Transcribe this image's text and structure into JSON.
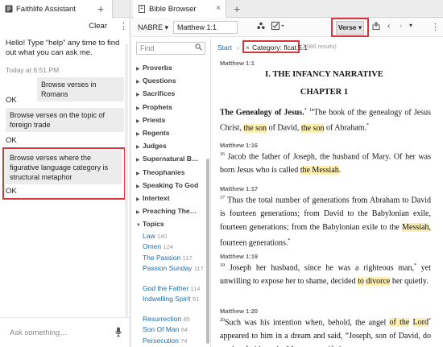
{
  "assistant": {
    "tab_title": "Faithlife Assistant",
    "tab_add": "+",
    "clear_label": "Clear",
    "kebab": "⋮",
    "greeting": "Hello! Type “help” any time to find out what you can ask me.",
    "timestamp": "Today at 6:51 PM",
    "messages": [
      {
        "user": "Browse verses in Romans",
        "reply": "OK"
      },
      {
        "user": "Browse verses on the topic of foreign trade",
        "reply": "OK"
      },
      {
        "user": "Browse verses where the figurative language category is structural metaphor",
        "reply": "OK"
      }
    ],
    "ask_placeholder": "Ask something…",
    "mic_icon": "microphone-icon"
  },
  "browser": {
    "tab_title": "Bible Browser",
    "tab_add": "+",
    "version": "NABRE",
    "reference": "Matthew 1:1",
    "verse_button": "Verse",
    "filter_placeholder": "Find",
    "filters": [
      "Proverbs",
      "Questions",
      "Sacrifices",
      "Prophets",
      "Priests",
      "Regents",
      "Judges",
      "Supernatural B…",
      "Theophanies",
      "Speaking To God",
      "Intertext",
      "Preaching The…",
      "Topics"
    ],
    "topics": [
      {
        "name": "Law",
        "count": "140"
      },
      {
        "name": "Omen",
        "count": "124"
      },
      {
        "name": "The Passion",
        "count": "117"
      },
      {
        "name": "Passion Sunday",
        "count": "117"
      },
      {
        "name": "God the Father",
        "count": "114"
      },
      {
        "name": "Indwelling Spirit",
        "count": "91"
      },
      {
        "name": "Resurrection",
        "count": "85"
      },
      {
        "name": "Son Of Man",
        "count": "84"
      },
      {
        "name": "Persecution",
        "count": "74"
      }
    ],
    "crumbs": {
      "start": "Start",
      "sep": "›",
      "category": "Category: flcat.5.1",
      "close": "×",
      "results": "(3,986 results)"
    },
    "passage": {
      "ref1": "Matthew 1:1",
      "heading1": "I. THE INFANCY NARRATIVE",
      "heading2": "CHAPTER 1",
      "subheading": "The Genealogy of Jesus.",
      "v1_num": "1",
      "v1_a": "The book of the genealogy of Jesus Christ, ",
      "v1_hl1": "the son",
      "v1_b": " of David, ",
      "v1_hl2": "the son",
      "v1_c": " of Abraham.",
      "ref2": "Matthew 1:16",
      "v16_num": "16",
      "v16_a": "Jacob the father of Joseph, the husband of Mary. Of her was born Jesus who is called ",
      "v16_hl": "the Messiah",
      "v16_b": ".",
      "ref3": "Matthew 1:17",
      "v17_num": "17",
      "v17_a": "Thus the total number of generations from Abraham to David is fourteen generations; from David to the Babylonian exile, fourteen generations; from the Babylonian exile to the ",
      "v17_hl": "Messiah",
      "v17_b": ", fourteen generations.",
      "ref4": "Matthew 1:19",
      "v19_num": "19",
      "v19_a": "Joseph her husband, since he was a righteous man,",
      "v19_b": " yet unwilling to expose her to shame, decided ",
      "v19_hl1": "to",
      "v19_hl2": "divorce",
      "v19_c": " her quietly.",
      "ref5": "Matthew 1:20",
      "v20_num": "20",
      "v20_a": "Such was his intention when, behold, the angel ",
      "v20_hl1": "of the",
      "v20_hl2": "Lord",
      "v20_b": " appeared to him in a dream and said, “Joseph, son of David, do not be afraid to take Mary your wife into"
    }
  },
  "colors": {
    "accent_blue": "#1f6bb0",
    "highlight_yellow": "#fdeeb3",
    "annotation_red": "#d9363e"
  }
}
